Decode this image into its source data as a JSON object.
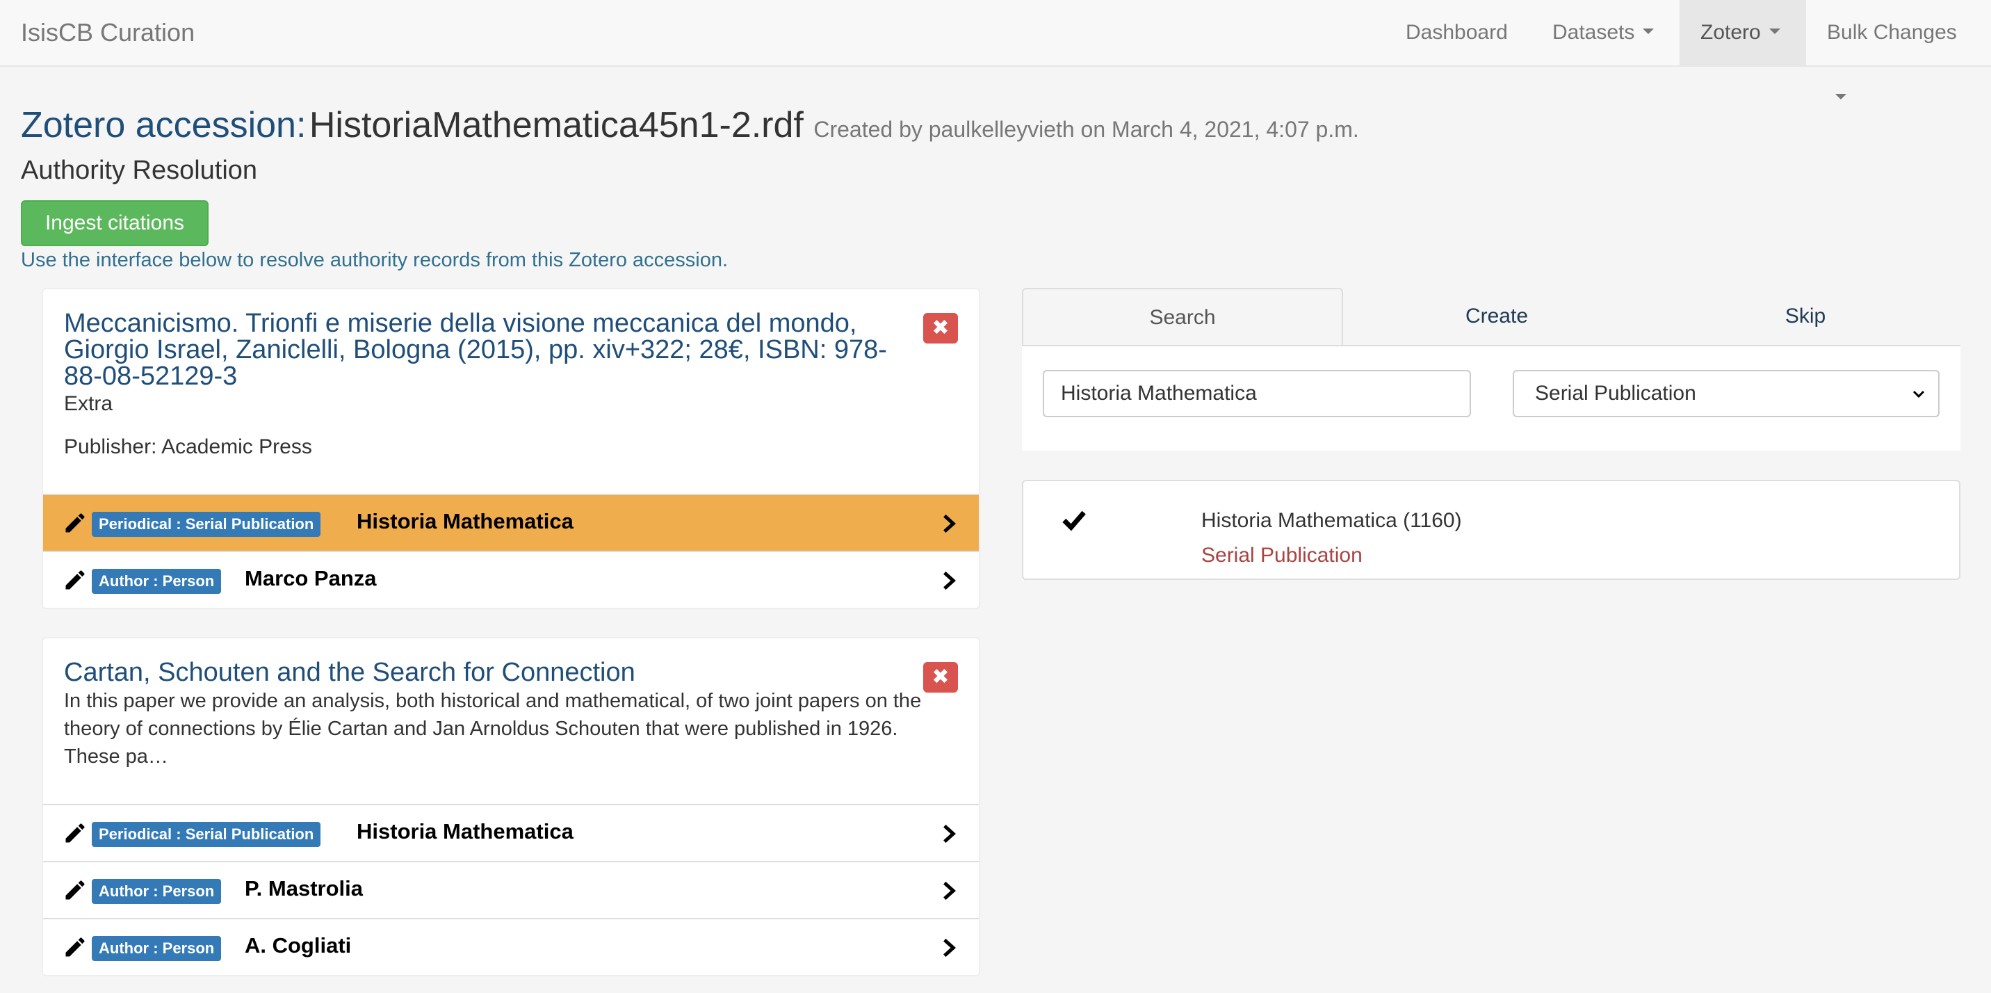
{
  "navbar": {
    "brand": "IsisCB Curation",
    "items": [
      {
        "label": "Dashboard"
      },
      {
        "label": "Datasets"
      },
      {
        "label": "Zotero"
      },
      {
        "label": "Bulk Changes"
      }
    ]
  },
  "header": {
    "label": "Zotero accession:",
    "filename": "HistoriaMathematica45n1-2.rdf",
    "created": "Created by paulkelleyvieth on March 4, 2021, 4:07 p.m.",
    "subtitle": "Authority Resolution",
    "ingest_button": "Ingest citations",
    "help": "Use the interface below to resolve authority records from this Zotero accession."
  },
  "citations": [
    {
      "title": "Meccanicismo. Trionfi e miserie della visione meccanica del mondo, Giorgio Israel, Zaniclelli, Bologna (2015), pp. xiv+322; 28€, ISBN: 978-88-08-52129-3",
      "extra": "Extra",
      "publisher": "Publisher: Academic Press",
      "authorities": [
        {
          "badge": "Periodical : Serial Publication",
          "name": "Historia Mathematica",
          "selected": true
        },
        {
          "badge": "Author : Person",
          "name": "Marco Panza",
          "selected": false
        }
      ]
    },
    {
      "title": "Cartan, Schouten and the Search for Connection",
      "abstract": "In this paper we provide an analysis, both historical and mathematical, of two joint papers on the theory of connections by Élie Cartan and Jan Arnoldus Schouten that were published in 1926. These pa…",
      "authorities": [
        {
          "badge": "Periodical : Serial Publication",
          "name": "Historia Mathematica",
          "selected": false
        },
        {
          "badge": "Author : Person",
          "name": "P. Mastrolia",
          "selected": false
        },
        {
          "badge": "Author : Person",
          "name": "A. Cogliati",
          "selected": false
        }
      ]
    }
  ],
  "resolver": {
    "tabs": [
      "Search",
      "Create",
      "Skip"
    ],
    "active_tab": "Search",
    "search_value": "Historia Mathematica",
    "type_selected": "Serial Publication",
    "results": [
      {
        "name": "Historia Mathematica (1160)",
        "type": "Serial Publication",
        "checked": true
      }
    ]
  },
  "colors": {
    "brand_blue": "#1f4e79",
    "success": "#5cb85c",
    "danger": "#d9534f",
    "warning_highlight": "#f0ad4e",
    "badge": "#337ab7",
    "result_type": "#a94442"
  },
  "icons": [
    "pencil-icon",
    "chevron-right-icon",
    "remove-icon",
    "checkmark-icon",
    "caret-down-icon"
  ]
}
